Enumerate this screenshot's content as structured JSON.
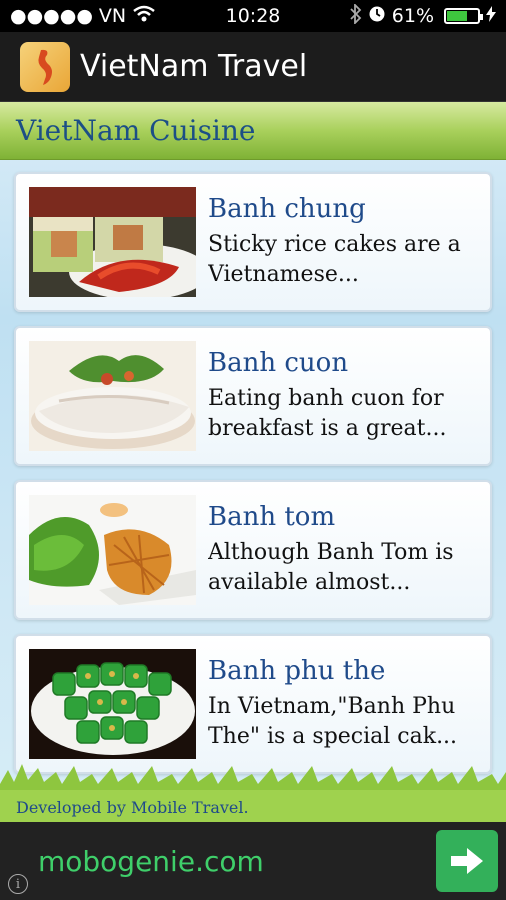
{
  "status_bar": {
    "carrier": "●●●●● VN",
    "time": "10:28",
    "battery_text": "61%",
    "battery_level": 0.61
  },
  "app": {
    "title": "VietNam Travel"
  },
  "section": {
    "title": "VietNam Cuisine"
  },
  "items": [
    {
      "title": "Banh chung",
      "description": "Sticky rice cakes are a Vietnamese..."
    },
    {
      "title": "Banh cuon",
      "description": "Eating banh cuon for breakfast is a great..."
    },
    {
      "title": "Banh tom",
      "description": "Although Banh Tom is available almost..."
    },
    {
      "title": "Banh phu the",
      "description": "In Vietnam,\"Banh Phu The\" is a special cak..."
    }
  ],
  "footer": {
    "credit": "Developed by Mobile Travel."
  },
  "ad": {
    "text": "mobogenie.com",
    "info_glyph": "i"
  },
  "colors": {
    "accent_green": "#7fb236",
    "title_blue": "#1f4a8a",
    "ad_green": "#3fcf6a"
  }
}
